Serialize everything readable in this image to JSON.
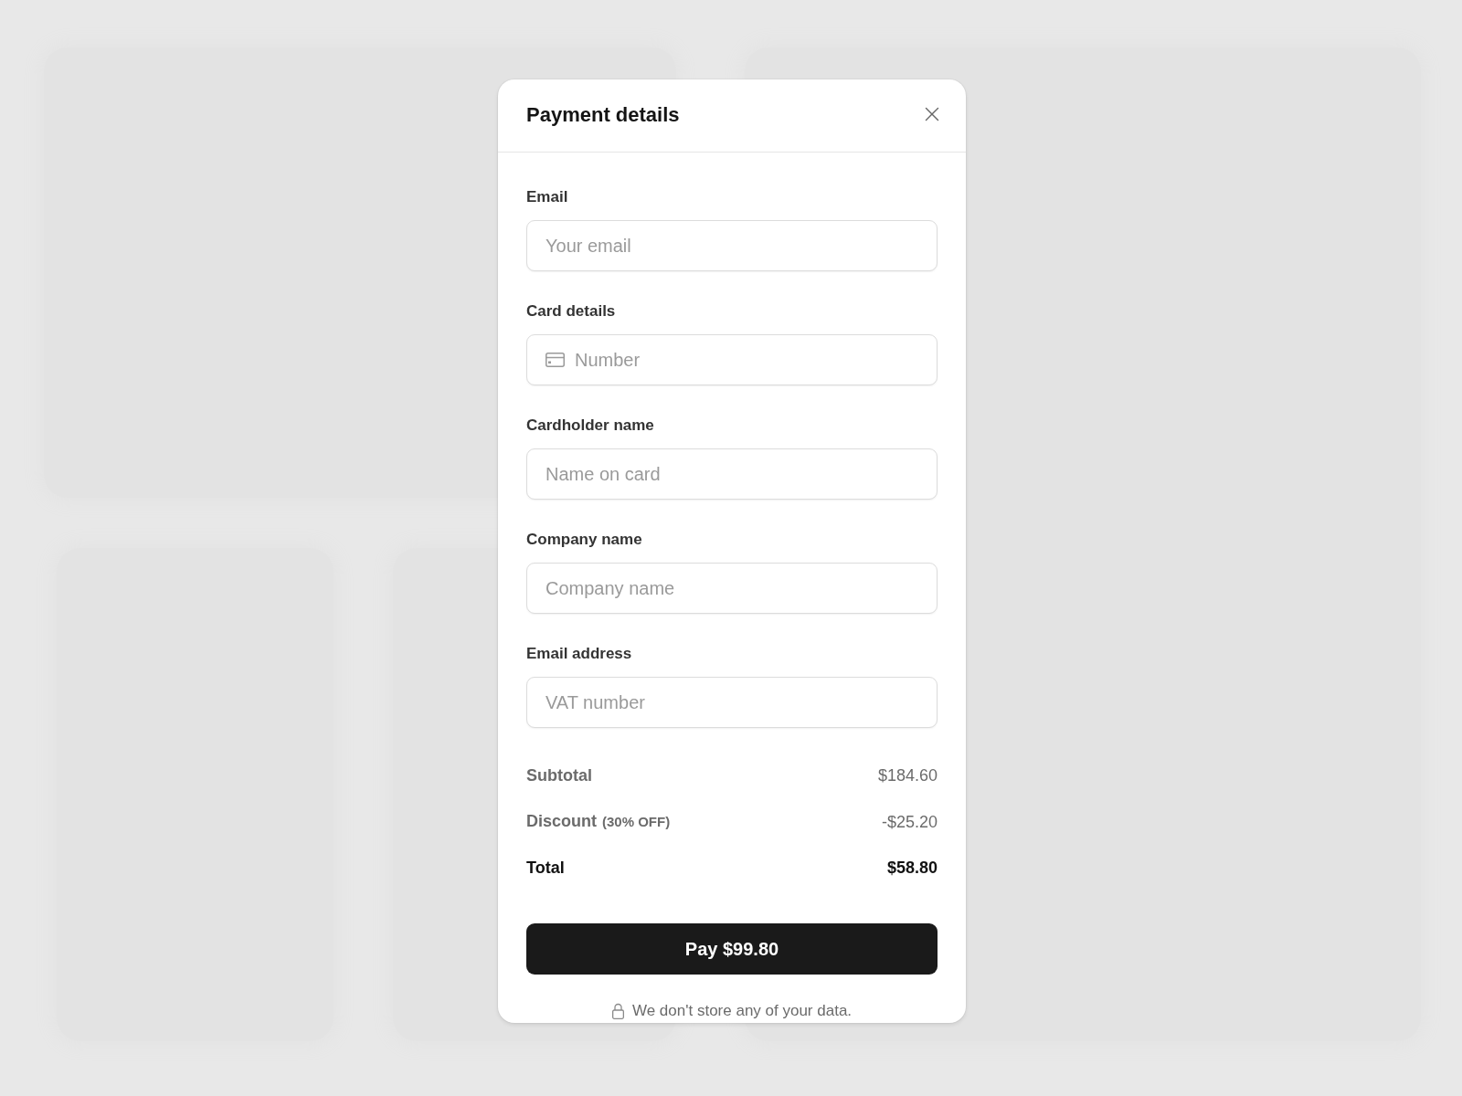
{
  "dialog": {
    "title": "Payment details"
  },
  "fields": [
    {
      "label": "Email",
      "placeholder": "Your email",
      "kind": "text"
    },
    {
      "label": "Card details",
      "placeholder": "Number",
      "kind": "card"
    },
    {
      "label": "Cardholder name",
      "placeholder": "Name on card",
      "kind": "text"
    },
    {
      "label": "Company name",
      "placeholder": "Company name",
      "kind": "text"
    },
    {
      "label": "Email address",
      "placeholder": "VAT number",
      "kind": "text"
    }
  ],
  "summary": [
    {
      "label": "Subtotal",
      "value": "$184.60",
      "kind": "line"
    },
    {
      "label": "Discount",
      "note": "(30% OFF)",
      "value": "-$25.20",
      "kind": "line"
    },
    {
      "label": "Total",
      "value": "$58.80",
      "kind": "total"
    }
  ],
  "pay_button": {
    "label": "Pay $99.80"
  },
  "footer_note": "We don't store any of your data."
}
